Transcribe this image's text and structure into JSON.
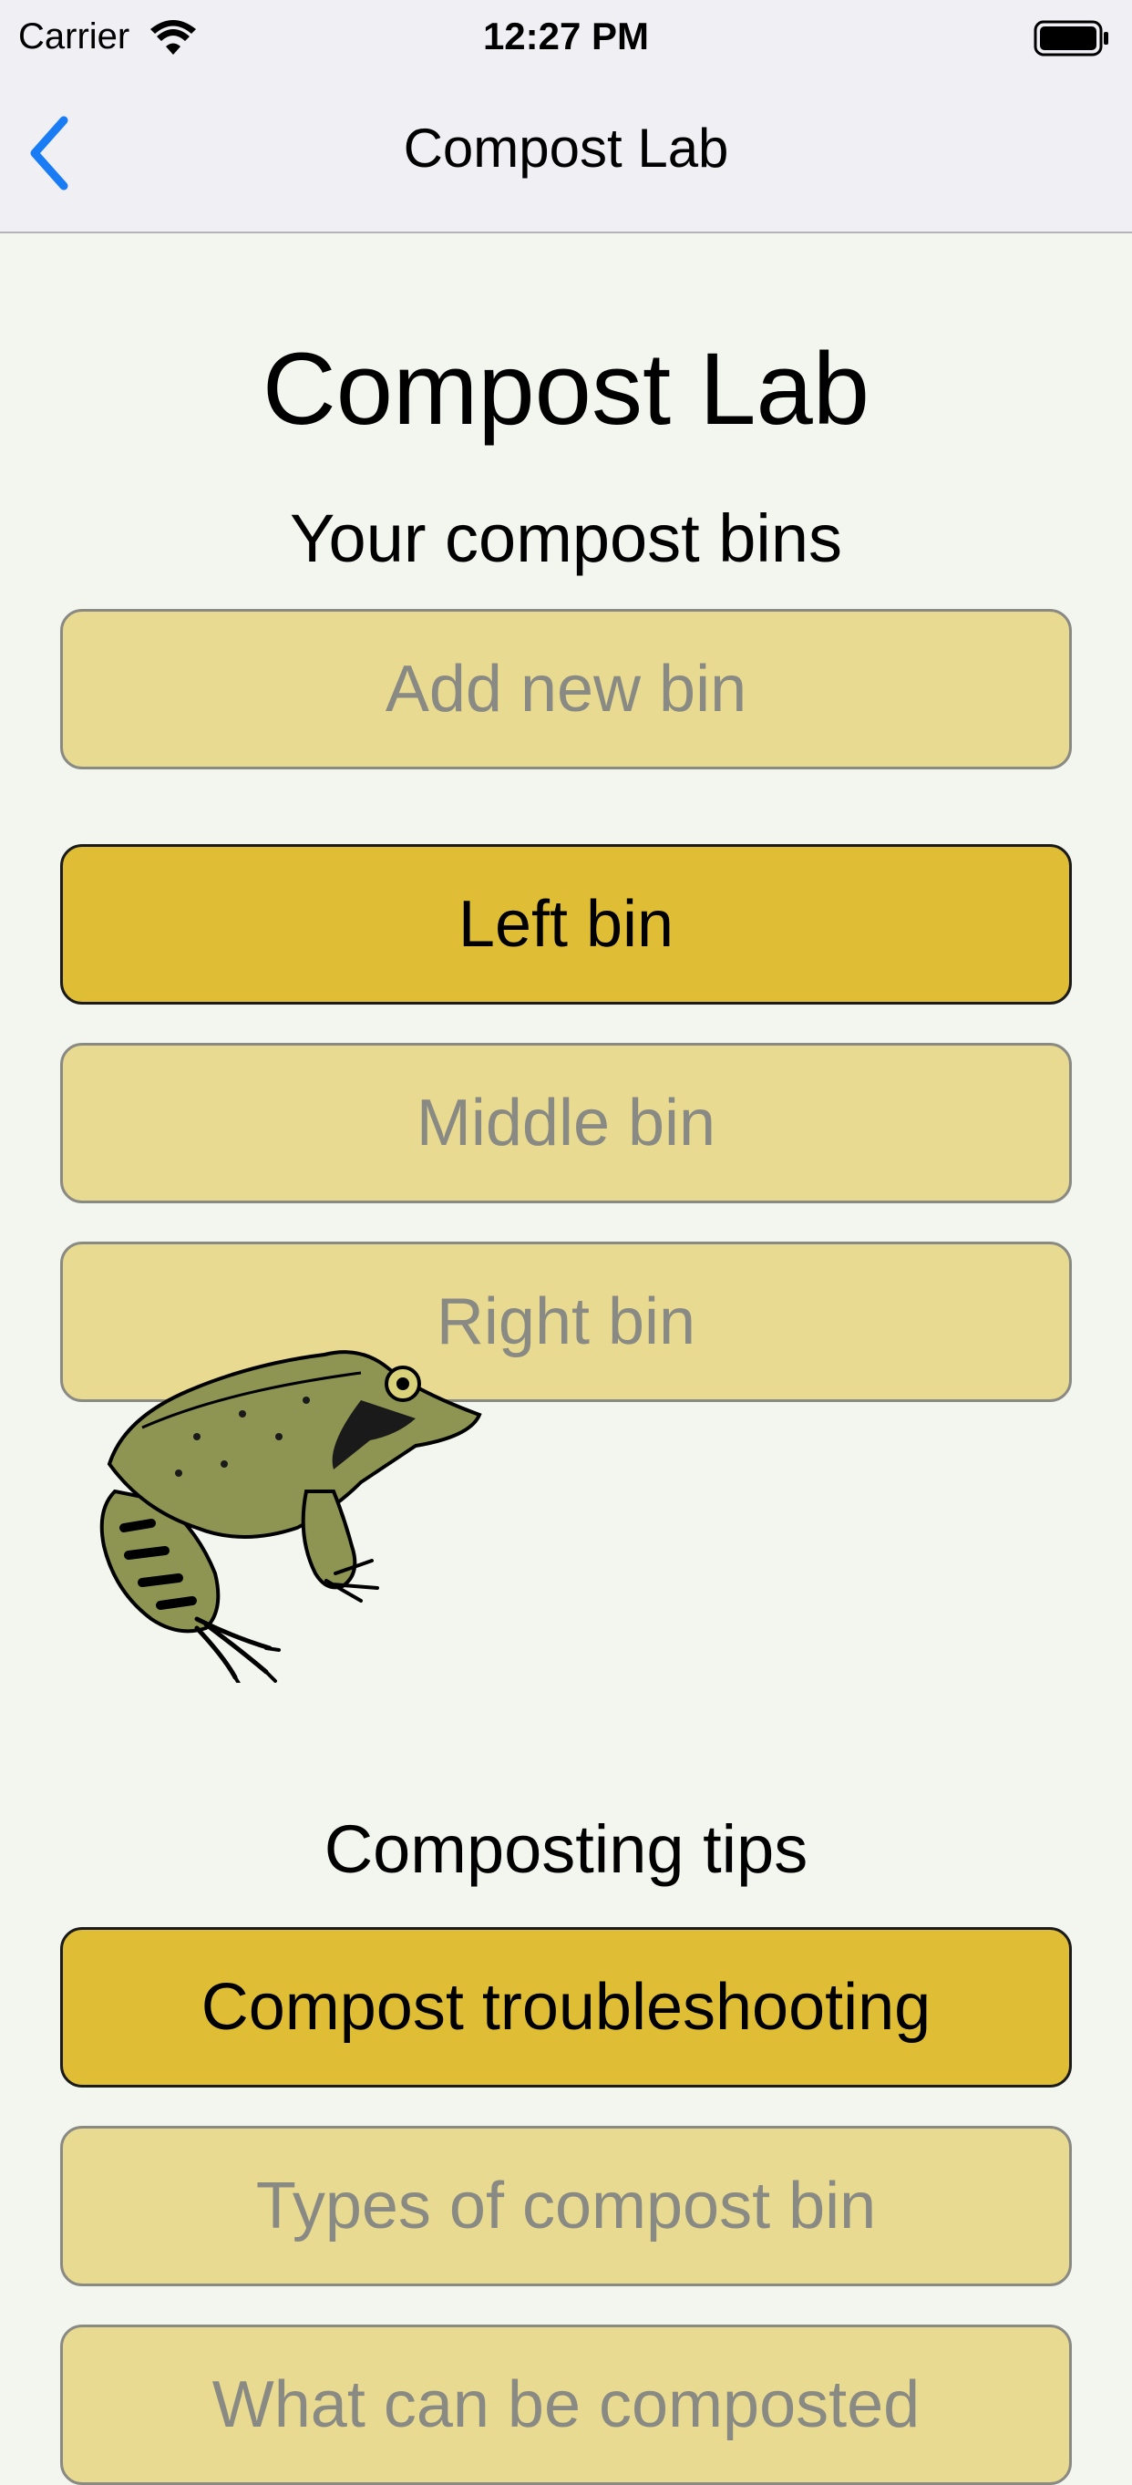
{
  "status_bar": {
    "carrier": "Carrier",
    "time": "12:27 PM",
    "icons": [
      "wifi-icon",
      "battery-icon"
    ]
  },
  "nav": {
    "back_icon": "chevron-left-icon",
    "title": "Compost Lab"
  },
  "page": {
    "title": "Compost Lab"
  },
  "bins_section": {
    "heading": "Your compost bins",
    "buttons": [
      {
        "label": "Add new bin",
        "active": false
      },
      {
        "label": "Left bin",
        "active": true
      },
      {
        "label": "Middle bin",
        "active": false
      },
      {
        "label": "Right bin",
        "active": false
      }
    ]
  },
  "illustration": {
    "icon": "frog-illustration"
  },
  "tips_section": {
    "heading": "Composting tips",
    "buttons": [
      {
        "label": "Compost troubleshooting",
        "active": true
      },
      {
        "label": "Types of compost bin",
        "active": false
      },
      {
        "label": "What can be composted",
        "active": false
      }
    ]
  },
  "colors": {
    "background": "#f3f6ee",
    "button_inactive": "#e8da90",
    "button_active": "#dfbe36",
    "accent_blue": "#1a7cf5",
    "frog_green": "#8e9553"
  }
}
